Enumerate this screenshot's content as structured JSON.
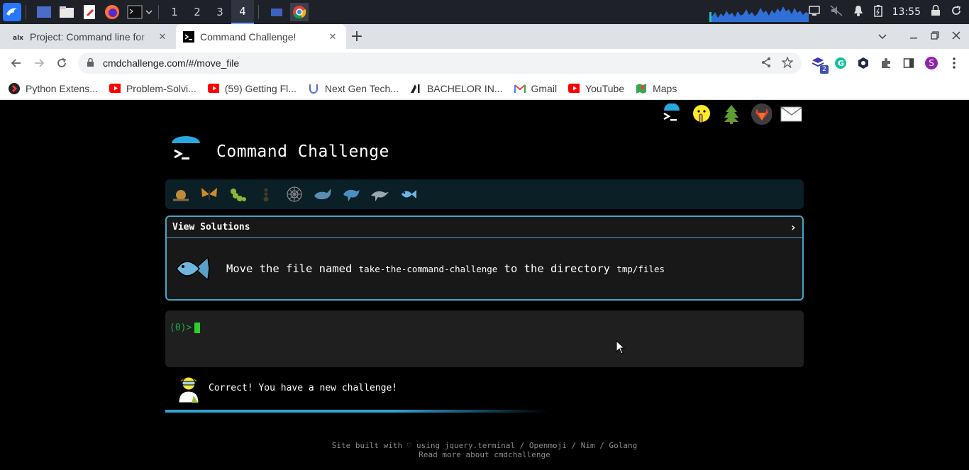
{
  "taskbar": {
    "workspaces": [
      "1",
      "2",
      "3",
      "4"
    ],
    "active_workspace": "4",
    "clock": "13:55"
  },
  "browser": {
    "tabs": [
      {
        "title": "Project: Command line for",
        "favicon": "alx-icon",
        "active": false
      },
      {
        "title": "Command Challenge!",
        "favicon": "terminal-icon",
        "active": true
      }
    ],
    "url": "cmdchallenge.com/#/move_file",
    "bookmarks": [
      {
        "label": "Python Extens...",
        "icon": "python-ext-icon"
      },
      {
        "label": "Problem-Solvi...",
        "icon": "youtube-icon"
      },
      {
        "label": "(59) Getting Fl...",
        "icon": "youtube-icon"
      },
      {
        "label": "Next Gen Tech...",
        "icon": "udacity-icon"
      },
      {
        "label": "BACHELOR IN...",
        "icon": "ai-icon"
      },
      {
        "label": "Gmail",
        "icon": "gmail-icon"
      },
      {
        "label": "YouTube",
        "icon": "youtube-icon"
      },
      {
        "label": "Maps",
        "icon": "maps-icon"
      }
    ],
    "avatar_letter": "S",
    "extension_badge": "2"
  },
  "page": {
    "title": "Command Challenge",
    "view_solutions": "View Solutions",
    "chevron": "›",
    "challenge": {
      "prefix": "Move the file named",
      "filename": "take-the-command-challenge",
      "middle": "to the directory",
      "dir": "tmp/files"
    },
    "prompt": "(0)>",
    "status_message": "Correct! You have a new challenge!",
    "footer_line1": "Site built with ♡ using jquery.terminal / Openmoji / Nim / Golang",
    "footer_line2": "Read more about cmdchallenge"
  },
  "colors": {
    "accent": "#4aa3c7",
    "prompt_green": "#1fa84a",
    "cursor_green": "#2bd12b",
    "levels_bg": "#0b1f26"
  }
}
